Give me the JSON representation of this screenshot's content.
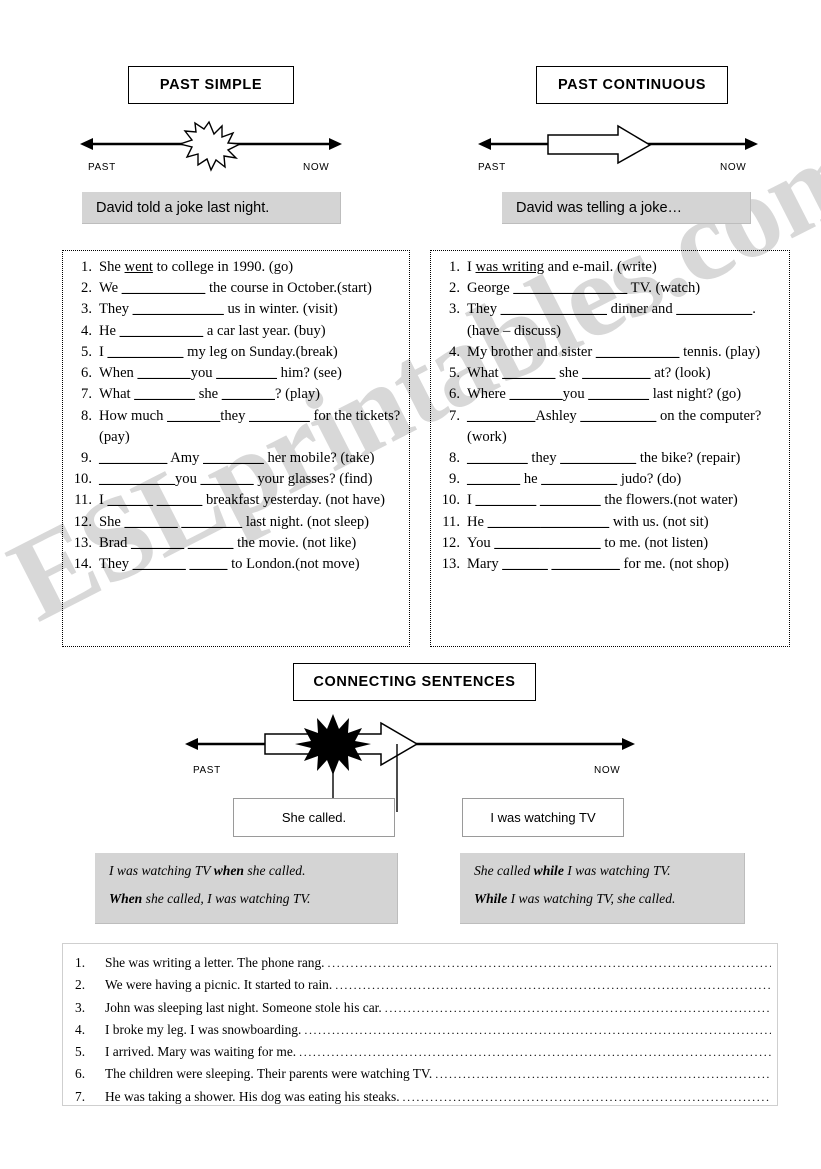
{
  "watermark": {
    "text": "ESLprintables.com"
  },
  "sections": {
    "past_simple": {
      "title": "PAST SIMPLE",
      "timeline": {
        "past_label": "PAST",
        "now_label": "NOW",
        "marker": "burst"
      },
      "example": "David told a joke last night."
    },
    "past_continuous": {
      "title": "PAST CONTINUOUS",
      "timeline": {
        "past_label": "PAST",
        "now_label": "NOW",
        "marker": "block-arrow"
      },
      "example": "David was telling a joke…"
    },
    "connecting": {
      "title": "CONNECTING SENTENCES",
      "timeline": {
        "past_label": "PAST",
        "now_label": "NOW"
      },
      "callout_left": "She called.",
      "callout_right": "I was watching TV",
      "rules_when": [
        {
          "pre": "I was watching TV ",
          "bold": "when",
          "post": " she called."
        },
        {
          "pre": "",
          "bold": "When",
          "post": " she called, I was watching TV."
        }
      ],
      "rules_while": [
        {
          "pre": "She called ",
          "bold": "while",
          "post": " I was watching TV."
        },
        {
          "pre": "",
          "bold": "While",
          "post": " I was watching TV, she called."
        }
      ]
    }
  },
  "exercise_left": {
    "items": [
      {
        "num": "1.",
        "pre": "She ",
        "answer": "went",
        "post": " to college in 1990. (go)"
      },
      {
        "num": "2.",
        "pre": "We ",
        "blank": "___________",
        "post": " the course in October.(start)"
      },
      {
        "num": "3.",
        "pre": "They ",
        "blank": "____________",
        "post": " us in winter. (visit)"
      },
      {
        "num": "4.",
        "pre": "He ",
        "blank": "___________",
        "post": " a car last year. (buy)"
      },
      {
        "num": "5.",
        "pre": "I ",
        "blank": "__________",
        "post": " my leg on Sunday.(break)"
      },
      {
        "num": "6.",
        "pre": "When ",
        "blank": "_______",
        "mid": "you ",
        "blank2": "________",
        "post": " him? (see)"
      },
      {
        "num": "7.",
        "pre": "What ",
        "blank": "________",
        "mid": " she ",
        "blank2": "_______",
        "post": "? (play)"
      },
      {
        "num": "8.",
        "pre": "How much ",
        "blank": "_______",
        "mid": "they ",
        "blank2": "________",
        "post": " for the tickets? (pay)"
      },
      {
        "num": "9.",
        "pre": "",
        "blank": "_________",
        "mid": " Amy ",
        "blank2": "________",
        "post": " her mobile? (take)"
      },
      {
        "num": "10.",
        "pre": "",
        "blank": "__________",
        "mid": "you ",
        "blank2": "_______",
        "post": " your glasses? (find)"
      },
      {
        "num": "11.",
        "pre": "I ",
        "blank": "______",
        "mid": " ",
        "blank2": "______",
        "post": " breakfast yesterday. (not have)"
      },
      {
        "num": "12.",
        "pre": "She ",
        "blank": "_______",
        "mid": " ",
        "blank2": "________",
        "post": " last night. (not sleep)"
      },
      {
        "num": "13.",
        "pre": "Brad ",
        "blank": "_______",
        "mid": " ",
        "blank2": "______",
        "post": " the movie. (not like)"
      },
      {
        "num": "14.",
        "pre": "They ",
        "blank": "_______",
        "mid": " ",
        "blank2": "_____",
        "post": " to London.(not move)"
      }
    ]
  },
  "exercise_right": {
    "items": [
      {
        "num": "1.",
        "pre": "I ",
        "answer": "was writing",
        "post": " and e-mail. (write)"
      },
      {
        "num": "2.",
        "pre": "George ",
        "blank": "_______________",
        "post": " TV. (watch)"
      },
      {
        "num": "3.",
        "pre": "They ",
        "blank": "______________",
        "mid": " dinner and ",
        "blank2": "__________",
        "post": ". (have – discuss)"
      },
      {
        "num": "4.",
        "pre": "My brother and sister ",
        "blank": "___________",
        "post": " tennis. (play)"
      },
      {
        "num": "5.",
        "pre": "What ",
        "blank": "_______",
        "mid": " she ",
        "blank2": "_________",
        "post": " at? (look)"
      },
      {
        "num": "6.",
        "pre": "Where ",
        "blank": "_______",
        "mid": "you ",
        "blank2": "________",
        "post": " last night? (go)"
      },
      {
        "num": "7.",
        "pre": "",
        "blank": "_________",
        "mid": "Ashley ",
        "blank2": "__________",
        "post": " on the computer? (work)"
      },
      {
        "num": "8.",
        "pre": "",
        "blank": "________",
        "mid": " they ",
        "blank2": "__________",
        "post": " the bike? (repair)"
      },
      {
        "num": "9.",
        "pre": "",
        "blank": "_______",
        "mid": " he ",
        "blank2": "__________",
        "post": " judo? (do)"
      },
      {
        "num": "10.",
        "pre": "   I ",
        "blank": "________",
        "mid": " ",
        "blank2": "________",
        "post": " the flowers.(not water)"
      },
      {
        "num": "11.",
        "pre": "He ",
        "blank": "_______",
        "mid": "",
        "blank2": "_________",
        "post": " with us. (not sit)"
      },
      {
        "num": "12.",
        "pre": "You ",
        "blank": "______",
        "mid": "",
        "blank2": "________",
        "post": " to me. (not listen)"
      },
      {
        "num": "13.",
        "pre": "Mary ",
        "blank": "______",
        "mid": " ",
        "blank2": "_________",
        "post": " for me. (not shop)"
      }
    ]
  },
  "bottom_list": {
    "items": [
      {
        "num": "1.",
        "text": "She was writing a letter. The phone rang."
      },
      {
        "num": "2.",
        "text": "We were having a picnic. It started to rain."
      },
      {
        "num": "3.",
        "text": "John was sleeping last night. Someone stole his car."
      },
      {
        "num": "4.",
        "text": "I broke my leg. I was snowboarding."
      },
      {
        "num": "5.",
        "text": "I arrived. Mary was waiting for me."
      },
      {
        "num": "6.",
        "text": "The children were sleeping. Their parents were watching TV."
      },
      {
        "num": "7.",
        "text": "He was taking a shower. His dog was eating his steaks."
      }
    ],
    "dots": "........................................................................................................."
  },
  "colors": {
    "banner_gray": "#d4d4d4",
    "watermark_gray": "#d2d2d2",
    "ink": "#000000",
    "table_border": "#cfcfcf"
  }
}
